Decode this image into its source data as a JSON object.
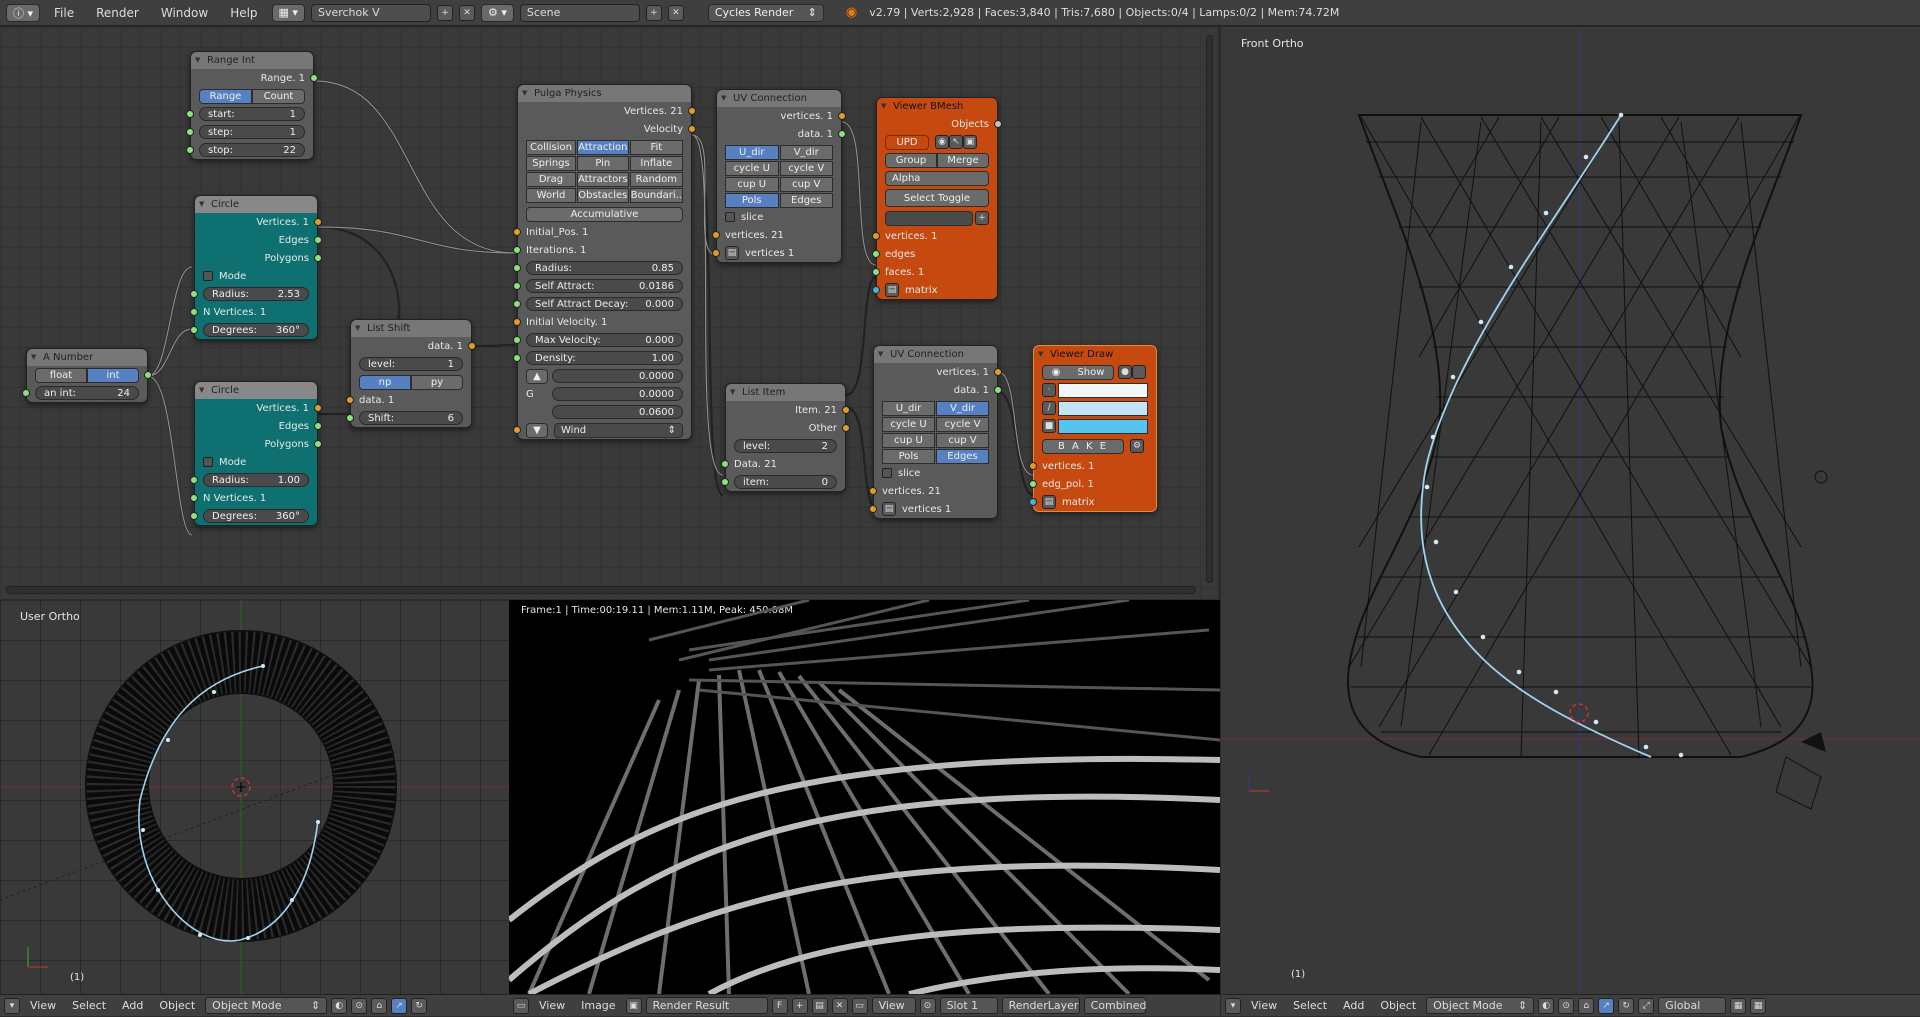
{
  "topbar": {
    "menus": [
      "File",
      "Render",
      "Window",
      "Help"
    ],
    "screen_layout": "Sverchok V",
    "scene": "Scene",
    "render_engine": "Cycles Render",
    "stats": "v2.79 | Verts:2,928 | Faces:3,840 | Tris:7,680 | Objects:0/4 | Lamps:0/2 | Mem:74.72M"
  },
  "nodes": {
    "range_int": {
      "title": "Range Int",
      "out": "Range. 1",
      "modes": [
        "Range",
        "Count"
      ],
      "start_label": "start:",
      "start": "1",
      "step_label": "step:",
      "step": "1",
      "stop_label": "stop:",
      "stop": "22"
    },
    "circle1": {
      "title": "Circle",
      "outs": [
        "Vertices. 1",
        "Edges",
        "Polygons"
      ],
      "mode": "Mode",
      "radius_label": "Radius:",
      "radius": "2.53",
      "nverts": "N Vertices. 1",
      "deg_label": "Degrees:",
      "deg": "360°"
    },
    "circle2": {
      "title": "Circle",
      "outs": [
        "Vertices. 1",
        "Edges",
        "Polygons"
      ],
      "mode": "Mode",
      "radius_label": "Radius:",
      "radius": "1.00",
      "nverts": "N Vertices. 1",
      "deg_label": "Degrees:",
      "deg": "360°"
    },
    "a_number": {
      "title": "A Number",
      "modes": [
        "float",
        "int"
      ],
      "label": "an int:",
      "value": "24"
    },
    "list_shift": {
      "title": "List Shift",
      "out": "data. 1",
      "level_label": "level:",
      "level": "1",
      "modes": [
        "np",
        "py"
      ],
      "in": "data. 1",
      "shift_label": "Shift:",
      "shift": "6"
    },
    "pulga": {
      "title": "Pulga Physics",
      "outs": [
        "Vertices. 21",
        "Velocity"
      ],
      "toggles": [
        "Collision",
        "Attraction",
        "Fit",
        "Springs",
        "Pin",
        "Inflate",
        "Drag",
        "Attractors",
        "Random",
        "World",
        "Obstacles",
        "Boundari.."
      ],
      "accumulative": "Accumulative",
      "inputs": [
        "Initial_Pos. 1",
        "Iterations. 1"
      ],
      "params": [
        {
          "label": "Radius:",
          "value": "0.85"
        },
        {
          "label": "Self Attract:",
          "value": "0.0186"
        },
        {
          "label": "Self Attract Decay:",
          "value": "0.000"
        }
      ],
      "initial_velocity": "Initial Velocity. 1",
      "params2": [
        {
          "label": "Max Velocity:",
          "value": "0.000"
        },
        {
          "label": "Density:",
          "value": "1.00"
        }
      ],
      "g_label": "G",
      "vec": [
        "0.0000",
        "0.0000",
        "0.0600"
      ],
      "wind": "Wind"
    },
    "uv1": {
      "title": "UV Connection",
      "outs": [
        "vertices. 1",
        "data. 1"
      ],
      "grid": [
        "U_dir",
        "V_dir",
        "cycle U",
        "cycle V",
        "cup U",
        "cup V",
        "Pols",
        "Edges"
      ],
      "slice": "slice",
      "ins": [
        "vertices. 21",
        "vertices 1"
      ]
    },
    "viewer_bmesh": {
      "title": "Viewer BMesh",
      "out": "Objects",
      "upd": "UPD",
      "group": "Group",
      "merge": "Merge",
      "alpha": "Alpha",
      "select_toggle": "Select Toggle",
      "ins": [
        "vertices. 1",
        "edges",
        "faces. 1",
        "matrix"
      ]
    },
    "list_item": {
      "title": "List Item",
      "outs": [
        "Item. 21",
        "Other"
      ],
      "level_label": "level:",
      "level": "2",
      "in": "Data. 21",
      "item_label": "item:",
      "item": "0"
    },
    "uv2": {
      "title": "UV Connection",
      "outs": [
        "vertices. 1",
        "data. 1"
      ],
      "grid": [
        "U_dir",
        "V_dir",
        "cycle U",
        "cycle V",
        "cup U",
        "cup V",
        "Pols",
        "Edges"
      ],
      "slice": "slice",
      "ins": [
        "vertices. 21",
        "vertices 1"
      ]
    },
    "viewer_draw": {
      "title": "Viewer Draw",
      "show": "Show",
      "bake": "B A K E",
      "ins": [
        "vertices. 1",
        "edg_pol. 1",
        "matrix"
      ],
      "colors": [
        "#f2f7fc",
        "#c3e4f6",
        "#55c5ef"
      ]
    }
  },
  "viewports": {
    "user_ortho": {
      "label": "User Ortho",
      "frame": "(1)"
    },
    "render_info": "Frame:1 | Time:00:19.11 | Mem:1.11M, Peak: 450.08M",
    "front_ortho": {
      "label": "Front Ortho",
      "frame": "(1)"
    }
  },
  "bottombars": {
    "left": {
      "menus": [
        "View",
        "Select",
        "Add",
        "Object"
      ],
      "mode": "Object Mode"
    },
    "middle": {
      "menus": [
        "View",
        "Image"
      ],
      "image": "Render Result",
      "f": "F",
      "view": "View",
      "slot": "Slot 1",
      "layer": "RenderLayer",
      "pass": "Combined"
    },
    "right": {
      "menus": [
        "View",
        "Select",
        "Add",
        "Object"
      ],
      "mode": "Object Mode",
      "orientation": "Global"
    }
  },
  "colors": {
    "teal_node": "#0e7070",
    "orange_node": "#c64a10",
    "active_button": "#5680c2",
    "curve": "#9fd3f0"
  }
}
